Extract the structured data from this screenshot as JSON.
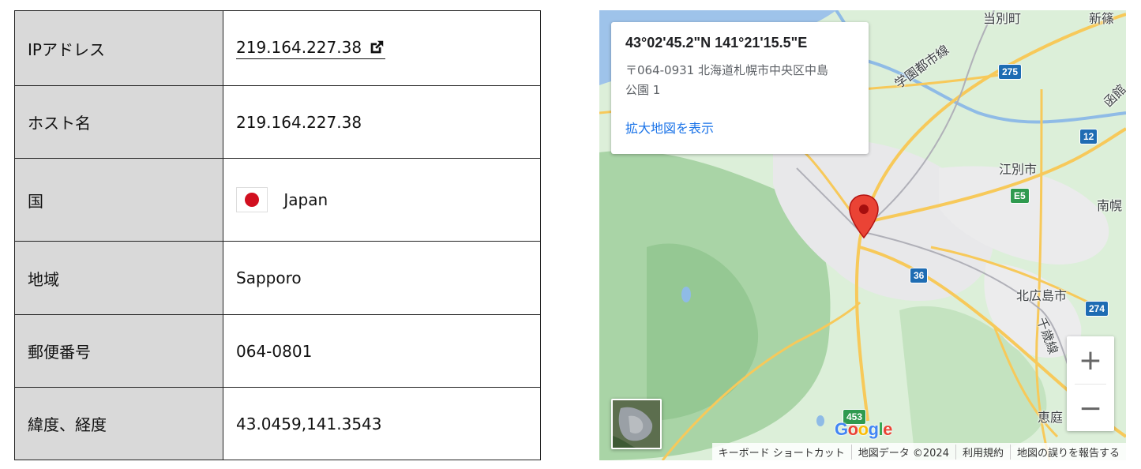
{
  "info": {
    "rows": [
      {
        "label": "IPアドレス",
        "value": "219.164.227.38"
      },
      {
        "label": "ホスト名",
        "value": "219.164.227.38"
      },
      {
        "label": "国",
        "value": "Japan"
      },
      {
        "label": "地域",
        "value": "Sapporo"
      },
      {
        "label": "郵便番号",
        "value": "064-0801"
      },
      {
        "label": "緯度、経度",
        "value": "43.0459,141.3543"
      }
    ],
    "flag_icon": "japan-flag-icon",
    "link_icon": "external-link-icon"
  },
  "map": {
    "card": {
      "coords": "43°02'45.2\"N 141°21'15.5\"E",
      "address_line1": "〒064-0931 北海道札幌市中央区中島",
      "address_line2": "公園 1",
      "link": "拡大地図を表示"
    },
    "labels": {
      "town1": "当別町",
      "town2": "新篠",
      "gakuen": "学園都市線",
      "ebetsu": "江別市",
      "minami": "南幌",
      "kitahiroshima": "北広島市",
      "chitose": "千歳線",
      "eniwa": "恵庭",
      "hako": "函館"
    },
    "routes": {
      "r275": "275",
      "r12": "12",
      "e5": "E5",
      "r36": "36",
      "r274": "274",
      "r453": "453"
    },
    "logo": "Google",
    "attribution": {
      "shortcuts": "キーボード ショートカット",
      "data": "地図データ ©2024",
      "terms": "利用規約",
      "report": "地図の誤りを報告する"
    },
    "zoom_in": "+",
    "zoom_out": "−",
    "colors": {
      "pin": "#ea4335",
      "link": "#1a73e8",
      "road": "#f7c95a",
      "water": "#8fbbe6"
    }
  }
}
